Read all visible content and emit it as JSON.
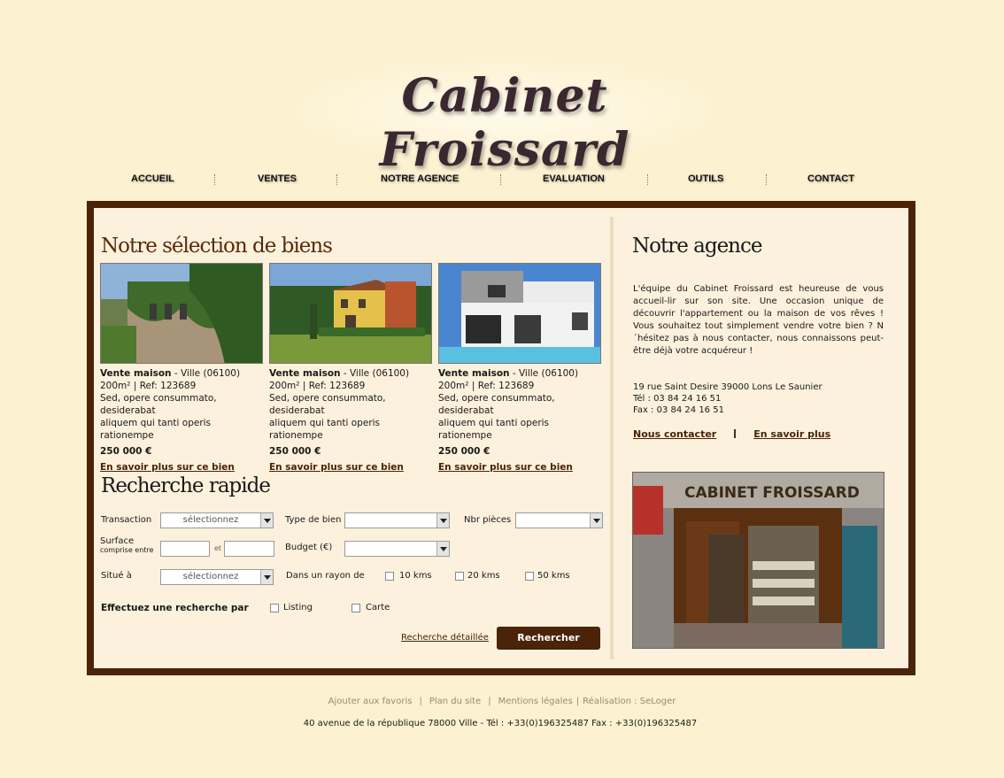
{
  "brand": {
    "logo_text": "Cabinet Froissard"
  },
  "nav": [
    "ACCUEIL",
    "VENTES",
    "NOTRE AGENCE",
    "EVALUATION",
    "OUTILS",
    "CONTACT"
  ],
  "selection": {
    "title": "Notre sélection de biens",
    "cards": [
      {
        "type": "Vente maison",
        "city": " - Ville (06100)",
        "area_ref": "200m² | Ref: 123689",
        "desc1": "Sed, opere consummato, desiderabat",
        "desc2": "aliquem qui tanti operis rationempe",
        "price": "250 000 €",
        "link": "En savoir plus sur ce bien"
      },
      {
        "type": "Vente maison",
        "city": " - Ville (06100)",
        "area_ref": "200m² | Ref: 123689",
        "desc1": "Sed, opere consummato, desiderabat",
        "desc2": "aliquem qui tanti operis rationempe",
        "price": "250 000 €",
        "link": "En savoir plus sur ce bien"
      },
      {
        "type": "Vente maison",
        "city": " - Ville (06100)",
        "area_ref": "200m² | Ref: 123689",
        "desc1": "Sed, opere consummato, desiderabat",
        "desc2": "aliquem qui tanti operis rationempe",
        "price": "250 000 €",
        "link": "En savoir plus sur ce bien"
      }
    ]
  },
  "agence": {
    "title": "Notre agence",
    "paragraph": "L'équipe du Cabinet Froissard est heureuse de vous accueil-lir sur son site. Une occasion unique de découvrir l'appartement ou la maison de vos rêves ! Vous souhaitez tout simplement vendre votre bien ? N´hésitez pas à nous contacter, nous connaissons peut-être déjà votre acquéreur !",
    "address": "19 rue Saint Desire 39000 Lons Le Saunier",
    "tel": "Tél : 03 84 24 16 51",
    "fax": "Fax : 03 84 24 16 51",
    "link_contact": "Nous contacter",
    "link_more": "En savoir plus",
    "shop_sign": "CABINET FROISSARD"
  },
  "search": {
    "title": "Recherche rapide",
    "transaction_label": "Transaction",
    "transaction_value": "sélectionnez",
    "type_label": "Type de bien",
    "type_value": "",
    "rooms_label": "Nbr pièces",
    "rooms_value": "",
    "surface_label": "Surface",
    "surface_sub": "comprise entre",
    "surface_et": "et",
    "budget_label": "Budget (€)",
    "budget_value": "",
    "situe_label": "Situé à",
    "situe_value": "sélectionnez",
    "rayon_label": "Dans un rayon de",
    "km10": "10 kms",
    "km20": "20 kms",
    "km50": "50 kms",
    "mode_label": "Effectuez une recherche par",
    "mode_listing": "Listing",
    "mode_carte": "Carte",
    "advanced_link": "Recherche détaillée",
    "submit": "Rechercher"
  },
  "footer": {
    "links": [
      "Ajouter aux favoris",
      "Plan du site",
      "Mentions légales",
      "Réalisation : SeLoger"
    ],
    "address": "40 avenue de la république  78000 Ville   -   Tél : +33(0)196325487 Fax : +33(0)196325487"
  }
}
